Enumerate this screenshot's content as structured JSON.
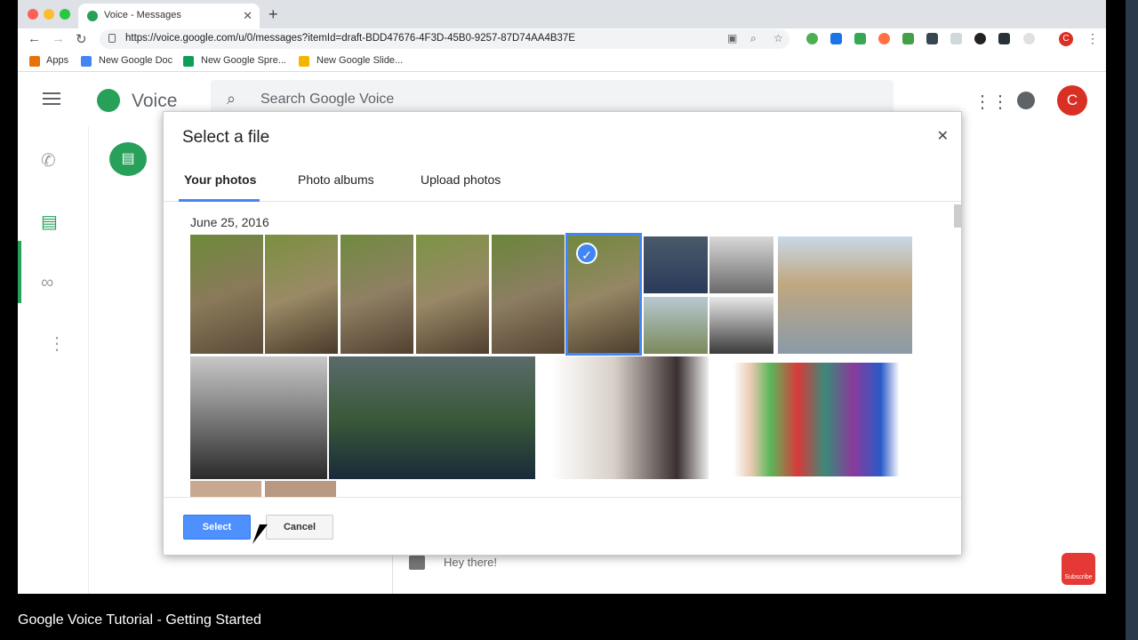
{
  "browser": {
    "tab_title": "Voice - Messages",
    "url": "https://voice.google.com/u/0/messages?itemId=draft-BDD47676-4F3D-45B0-9257-87D74AA4B37E",
    "avatar_letter": "C",
    "bookmarks": [
      {
        "label": "Apps",
        "icon": "apps-grid-icon"
      },
      {
        "label": "New Google Doc",
        "icon": "docs-icon"
      },
      {
        "label": "New Google Spre...",
        "icon": "sheets-icon"
      },
      {
        "label": "New Google Slide...",
        "icon": "slides-icon"
      }
    ]
  },
  "app": {
    "name": "Voice",
    "search_placeholder": "Search Google Voice",
    "avatar_letter": "C",
    "compose_text": "Hey there!"
  },
  "dialog": {
    "title": "Select a file",
    "tabs": [
      {
        "label": "Your photos",
        "active": true
      },
      {
        "label": "Photo albums",
        "active": false
      },
      {
        "label": "Upload photos",
        "active": false
      }
    ],
    "date": "June 25, 2016",
    "select_label": "Select",
    "cancel_label": "Cancel",
    "photos": [
      {
        "name": "cat-photo-1",
        "selected": false
      },
      {
        "name": "cat-photo-2",
        "selected": false
      },
      {
        "name": "cat-photo-3",
        "selected": false
      },
      {
        "name": "cat-photo-4",
        "selected": false
      },
      {
        "name": "cat-photo-5",
        "selected": false
      },
      {
        "name": "cat-photo-6",
        "selected": true
      },
      {
        "name": "man-portrait-1",
        "selected": false
      },
      {
        "name": "elderly-man-portrait-1",
        "selected": false
      },
      {
        "name": "young-man-portrait-1",
        "selected": false
      },
      {
        "name": "woman-portrait-1",
        "selected": false
      },
      {
        "name": "young-man-portrait-large",
        "selected": false
      },
      {
        "name": "elderly-man-portrait-large",
        "selected": false
      },
      {
        "name": "man-suit-portrait-large",
        "selected": false
      },
      {
        "name": "woman-portrait-large",
        "selected": false
      },
      {
        "name": "group-people-photo",
        "selected": false
      }
    ]
  },
  "caption": "Google Voice Tutorial - Getting Started",
  "subscribe": "Subscribe",
  "colors": {
    "accent": "#4285f4",
    "voice_green": "#27a05a",
    "avatar_red": "#d93025"
  }
}
